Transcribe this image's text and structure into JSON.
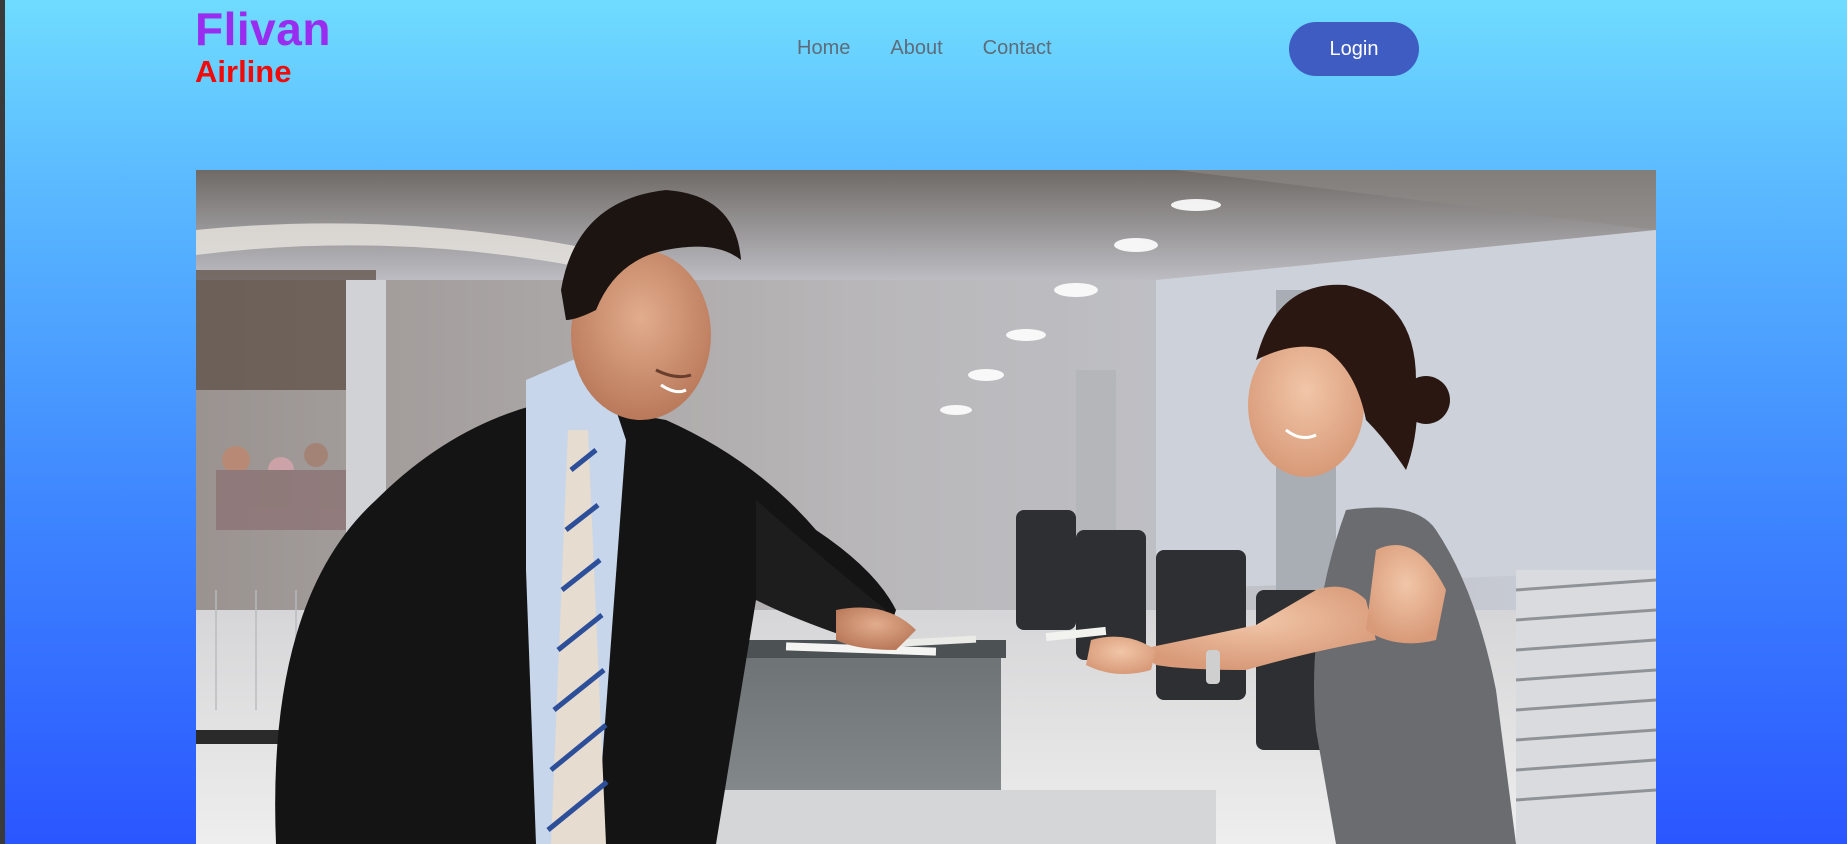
{
  "header": {
    "logo": {
      "title": "Flivan",
      "subtitle": "Airline"
    },
    "nav": [
      "Home",
      "About",
      "Contact"
    ],
    "login_label": "Login"
  },
  "hero": {
    "image": "Airline check-in counter: a businessman in a dark suit hands documents to a smiling female agent in a grey sleeveless dress"
  },
  "colors": {
    "logo_title": "#9a2cf0",
    "logo_subtitle": "#f00a0a",
    "login_button": "#3e5cc2",
    "nav_link": "#5d6b7a"
  }
}
